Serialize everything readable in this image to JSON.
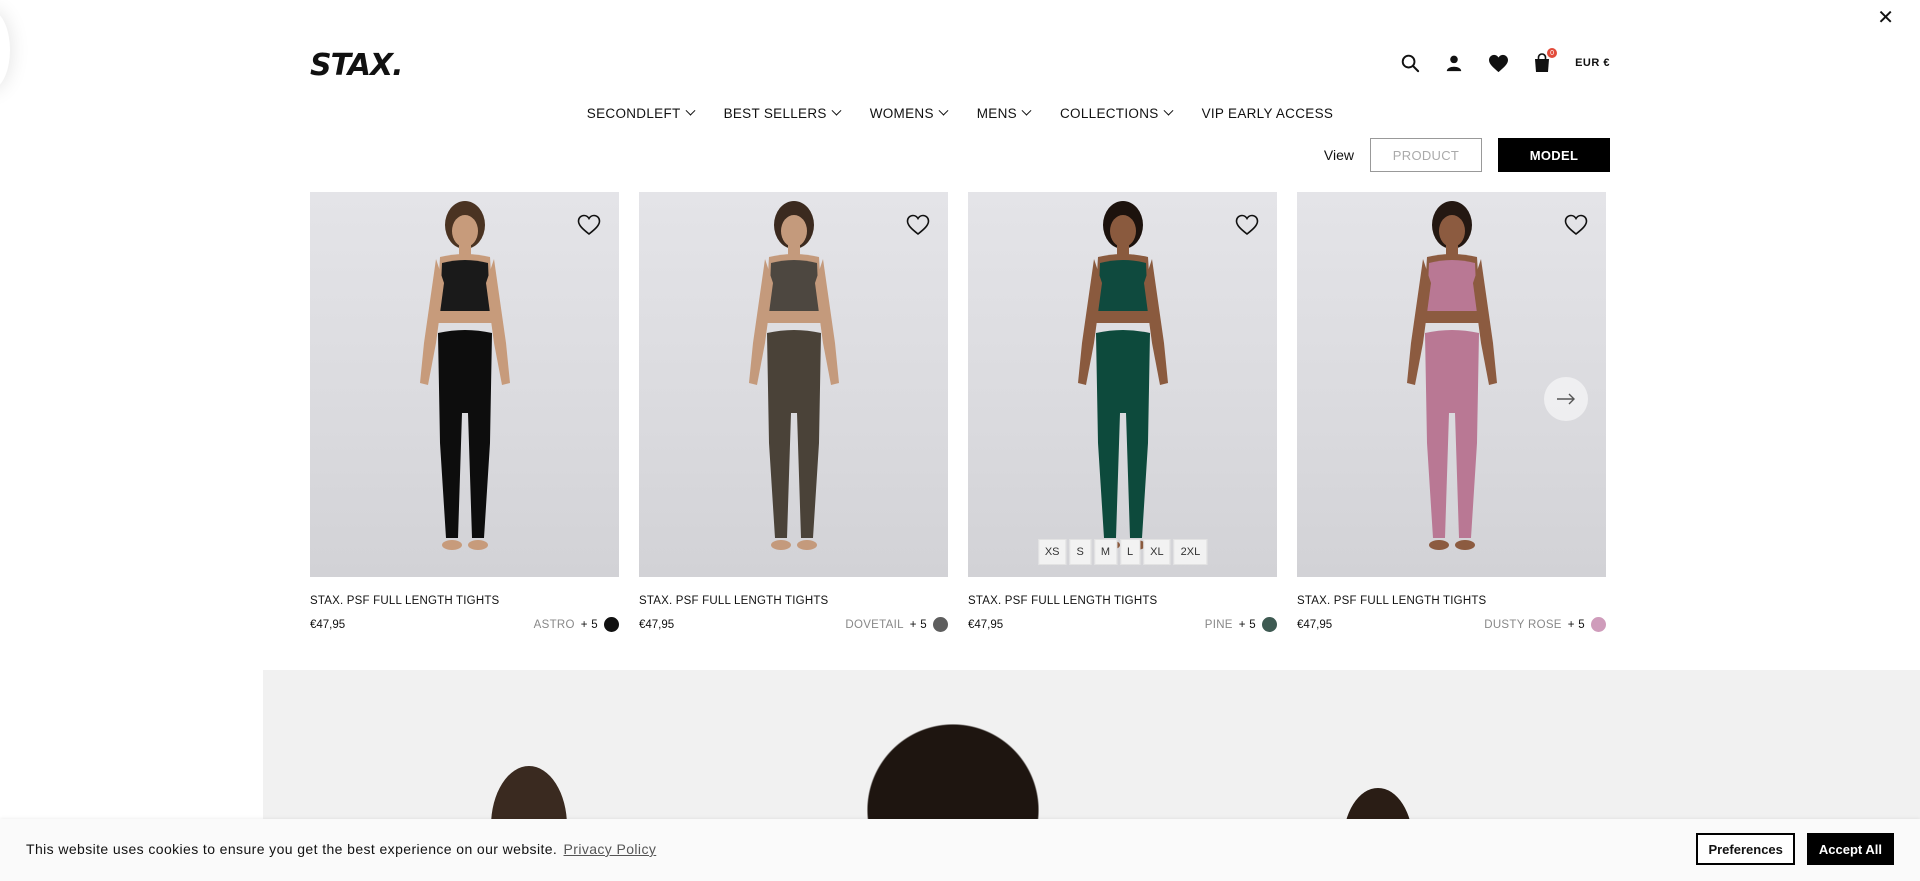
{
  "header": {
    "logo": "STAX.",
    "currency": "EUR €",
    "cart_count": "0"
  },
  "nav": {
    "items": [
      {
        "label": "SECONDLEFT",
        "dropdown": true
      },
      {
        "label": "BEST SELLERS",
        "dropdown": true
      },
      {
        "label": "WOMENS",
        "dropdown": true
      },
      {
        "label": "MENS",
        "dropdown": true
      },
      {
        "label": "COLLECTIONS",
        "dropdown": true
      },
      {
        "label": "VIP EARLY ACCESS",
        "dropdown": false
      }
    ]
  },
  "view_toggle": {
    "label": "View",
    "product": "PRODUCT",
    "model": "MODEL"
  },
  "products": [
    {
      "title": "STAX. PSF FULL LENGTH TIGHTS",
      "price": "€47,95",
      "colour": "ASTRO",
      "more": "+ 5",
      "swatch": "#111111",
      "top_color": "#1a1a1a",
      "leg_color": "#0d0d0d",
      "skin": "#c79b7b",
      "hair": "#4a3322"
    },
    {
      "title": "STAX. PSF FULL LENGTH TIGHTS",
      "price": "€47,95",
      "colour": "DOVETAIL",
      "more": "+ 5",
      "swatch": "#5e5e5e",
      "top_color": "#4d4740",
      "leg_color": "#4a4238",
      "skin": "#c49a7c",
      "hair": "#3b2a1f"
    },
    {
      "title": "STAX. PSF FULL LENGTH TIGHTS",
      "price": "€47,95",
      "colour": "PINE",
      "more": "+ 5",
      "swatch": "#3e5a52",
      "top_color": "#0f4a3e",
      "leg_color": "#0d4a3c",
      "skin": "#8a5a3e",
      "hair": "#1c120d"
    },
    {
      "title": "STAX. PSF FULL LENGTH TIGHTS",
      "price": "€47,95",
      "colour": "DUSTY ROSE",
      "more": "+ 5",
      "swatch": "#cf9cbb",
      "top_color": "#b97894",
      "leg_color": "#b97894",
      "skin": "#8c5b40",
      "hair": "#241812"
    }
  ],
  "sizes": [
    "XS",
    "S",
    "M",
    "L",
    "XL",
    "2XL"
  ],
  "cookie": {
    "text": "This website uses cookies to ensure you get the best experience on our website.",
    "link": "Privacy Policy",
    "preferences": "Preferences",
    "accept": "Accept All"
  },
  "colors": {
    "accent": "#000000",
    "badge": "#e24b3a",
    "banner_bg": "#f1f1f1"
  }
}
